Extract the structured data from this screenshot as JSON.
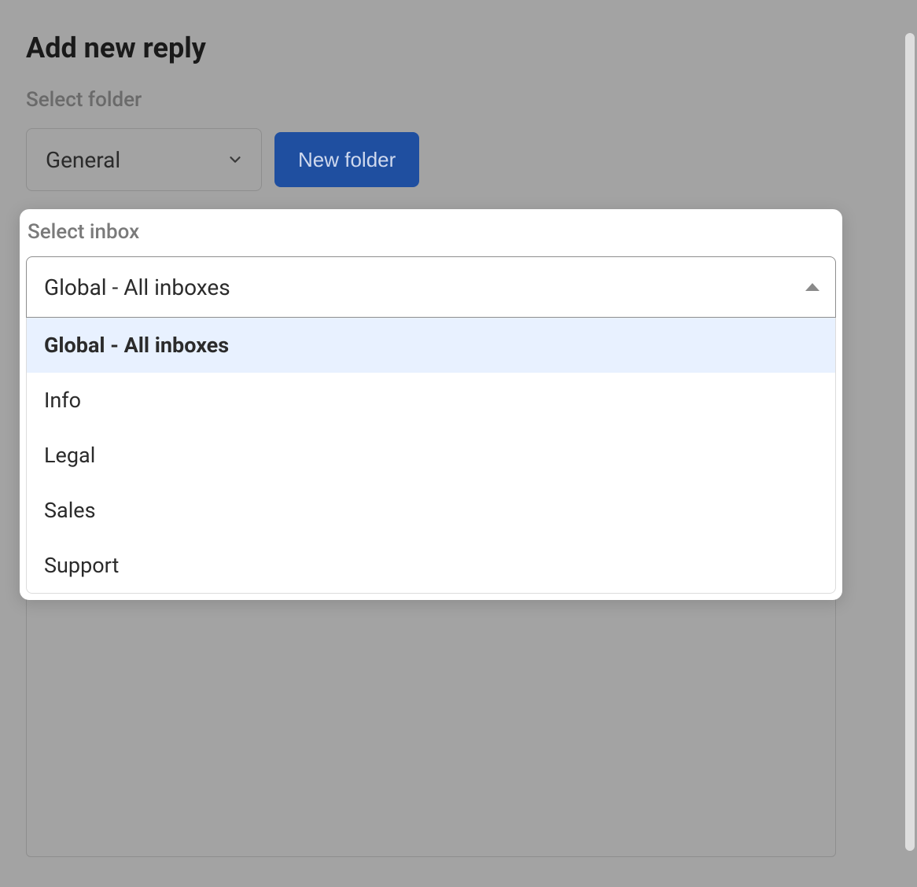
{
  "title": "Add new reply",
  "folder": {
    "label": "Select folder",
    "selected": "General",
    "new_button": "New folder"
  },
  "inbox": {
    "label": "Select inbox",
    "selected": "Global - All inboxes",
    "options": [
      "Global - All inboxes",
      "Info",
      "Legal",
      "Sales",
      "Support"
    ]
  },
  "colors": {
    "primary": "#1f4fa0",
    "highlight": "#e8f1ff",
    "overlay": "#a3a3a3"
  }
}
